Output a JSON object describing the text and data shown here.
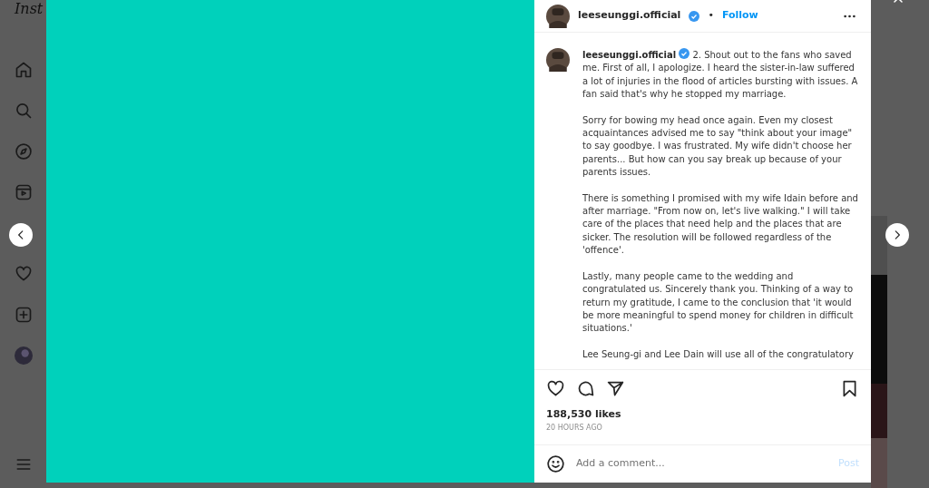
{
  "sidebar": {
    "logo": "Inst"
  },
  "post": {
    "author": "leeseunggi.official",
    "verified": true,
    "separator": "•",
    "follow": "Follow",
    "caption_author": "leeseunggi.official",
    "caption_verified": true,
    "caption": [
      "2. Shout out to the fans who saved me. First of all, I apologize. I heard the sister-in-law suffered a lot of injuries in the flood of articles bursting with issues. A fan said that's why he stopped my marriage.",
      "Sorry for bowing my head once again. Even my closest acquaintances advised me to say \"think about your image\" to say goodbye. I was frustrated. My wife didn't choose her parents... But how can you say break up because of your parents issues.",
      "There is something I promised with my wife Idain before and after marriage. \"From now on, let's live walking.\" I will take care of the places that need help and the places that are sicker. The resolution will be followed regardless of the 'offence'.",
      "Lastly, many people came to the wedding and congratulated us. Sincerely thank you. Thinking of a way to return my gratitude, I came to the conclusion that 'it would be more meaningful to spend money for children in difficult situations.'",
      "Lee Seung-gi and Lee Dain will use all of the congratulatory"
    ],
    "liked": false,
    "saved": false,
    "likes": "188,530 likes",
    "time": "20 HOURS AGO",
    "comment": {
      "placeholder": "Add a comment..."
    },
    "post_button": {
      "label": "Post",
      "disabled": true
    }
  }
}
